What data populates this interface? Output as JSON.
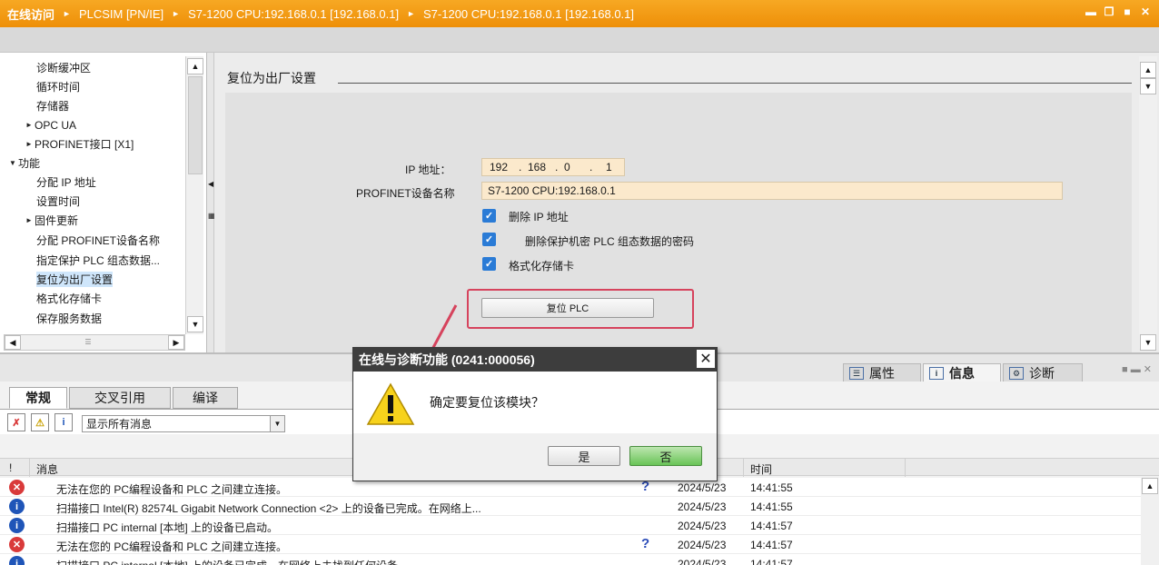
{
  "titlebar": {
    "crumbs": [
      "在线访问",
      "PLCSIM [PN/IE]",
      "S7-1200 CPU:192.168.0.1 [192.168.0.1]",
      "S7-1200 CPU:192.168.0.1 [192.168.0.1]"
    ]
  },
  "tree": {
    "items": [
      "诊断缓冲区",
      "循环时间",
      "存储器",
      "OPC UA",
      "PROFINET接口 [X1]",
      "功能",
      "分配 IP 地址",
      "设置时间",
      "固件更新",
      "分配 PROFINET设备名称",
      "指定保护 PLC 组态数据...",
      "复位为出厂设置",
      "格式化存储卡",
      "保存服务数据"
    ]
  },
  "main": {
    "section_title": "复位为出厂设置",
    "ip_label": "IP 地址：",
    "ip_segments": [
      "192",
      "168",
      "0",
      "1"
    ],
    "profinet_label": "PROFINET设备名称",
    "profinet_value": "S7-1200 CPU:192.168.0.1",
    "checkboxes": [
      "删除 IP 地址",
      "删除保护机密 PLC 组态数据的密码",
      "格式化存储卡"
    ],
    "reset_button": "复位 PLC"
  },
  "inspector_tabs": [
    "属性",
    "信息",
    "诊断"
  ],
  "bottom": {
    "tabs": [
      "常规",
      "交叉引用",
      "编译"
    ],
    "filter_select": "显示所有消息",
    "columns": [
      "!",
      "消息",
      "时间"
    ],
    "rows": [
      {
        "type": "error",
        "msg": "无法在您的 PC编程设备和 PLC 之间建立连接。",
        "help": "?",
        "date": "2024/5/23",
        "time": "14:41:55"
      },
      {
        "type": "info",
        "msg": "扫描接口 Intel(R) 82574L Gigabit Network Connection <2> 上的设备已完成。在网络上...",
        "help": "",
        "date": "2024/5/23",
        "time": "14:41:55"
      },
      {
        "type": "info",
        "msg": "扫描接口 PC internal [本地] 上的设备已启动。",
        "help": "",
        "date": "2024/5/23",
        "time": "14:41:57"
      },
      {
        "type": "error",
        "msg": "无法在您的 PC编程设备和 PLC 之间建立连接。",
        "help": "?",
        "date": "2024/5/23",
        "time": "14:41:57"
      },
      {
        "type": "info",
        "msg": "扫描接口 PC internal [本地] 上的设备已完成。在网络上未找到任何设备。",
        "help": "",
        "date": "2024/5/23",
        "time": "14:41:57"
      }
    ]
  },
  "dialog": {
    "title": "在线与诊断功能 (0241:000056)",
    "message": "确定要复位该模块？",
    "yes": "是",
    "no": "否"
  },
  "colors": {
    "titlebar": "#f39c12",
    "highlight": "#d6435d",
    "checkbox": "#2a7bd6",
    "field_bg": "#fbe9cc"
  }
}
